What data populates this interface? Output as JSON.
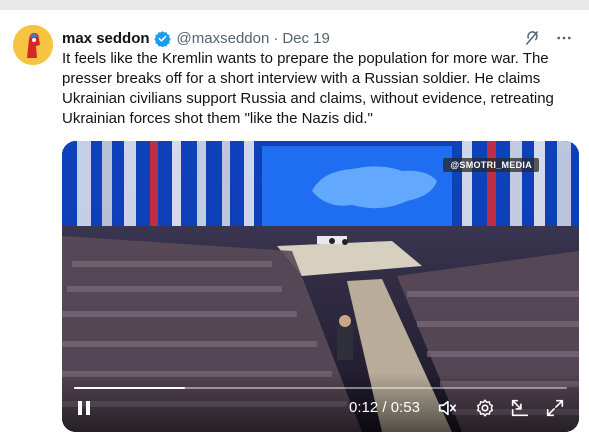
{
  "tweet": {
    "display_name": "max seddon",
    "handle": "@maxseddon",
    "separator": "·",
    "date": "Dec 19",
    "text": "It feels like the Kremlin wants to prepare the population for more war. The presser breaks off for a short interview with a Russian soldier. He claims Ukrainian civilians support Russia and claims, without evidence, retreating Ukrainian forces shot them \"like the Nazis did.\""
  },
  "video": {
    "watermark": "@SMOTRI_MEDIA",
    "current_time": "0:12",
    "time_separator": " / ",
    "duration": "0:53",
    "progress": 0.226
  },
  "icons": {
    "verified": "verified-badge-icon",
    "grok": "grok-icon",
    "more": "more-icon",
    "pause": "pause-icon",
    "mute": "mute-icon",
    "settings": "gear-icon",
    "dock": "dock-icon",
    "fullscreen": "fullscreen-icon"
  },
  "colors": {
    "verified": "#1d9bf0",
    "text": "#0f1419",
    "secondary": "#536471"
  }
}
